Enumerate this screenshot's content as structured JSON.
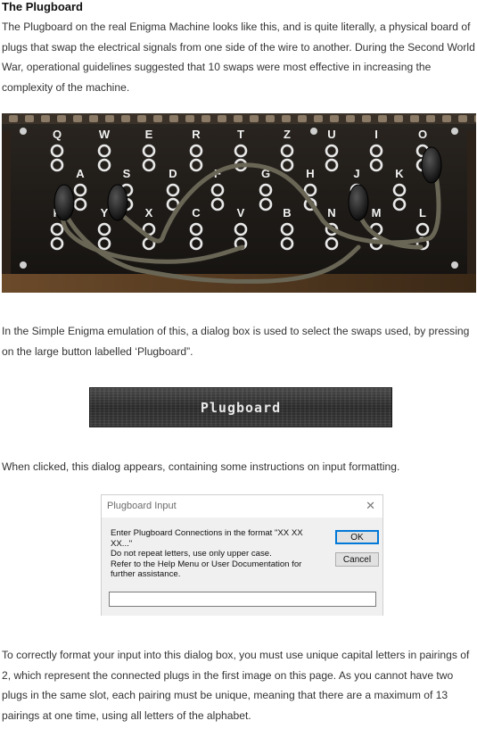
{
  "heading": "The Plugboard",
  "paragraphs": {
    "intro": "The Plugboard on the real Enigma Machine looks like this, and is quite literally, a physical board of plugs that swap the electrical signals from one side of the wire to another. During the Second World War, operational guidelines suggested that 10 swaps were most effective in increasing the complexity of the machine.",
    "emulation": "In the Simple Enigma emulation of this, a dialog box is used to select the swaps used, by pressing on the large button labelled ‘Plugboard”.",
    "clicked": "When clicked, this dialog appears, containing some instructions on input formatting.",
    "format": "To correctly format your input into this dialog box, you must use unique capital letters in pairings of 2, which represent the connected plugs in the first image on this page. As you cannot have two plugs in the same slot, each pairing must be unique, meaning that there are a maximum of 13 pairings at one time, using all letters of the alphabet."
  },
  "plugboard_photo": {
    "row1": [
      "Q",
      "W",
      "E",
      "R",
      "T",
      "Z",
      "U",
      "I",
      "O"
    ],
    "row2": [
      "A",
      "S",
      "D",
      "F",
      "G",
      "H",
      "J",
      "K"
    ],
    "row3": [
      "P",
      "Y",
      "X",
      "C",
      "V",
      "B",
      "N",
      "M",
      "L"
    ]
  },
  "plugboard_button": {
    "label": "Plugboard"
  },
  "dialog": {
    "title": "Plugboard Input",
    "close_glyph": "✕",
    "message_lines": [
      "Enter Plugboard Connections in the format \"XX XX XX...\"",
      "Do not repeat letters, use only upper case.",
      "Refer to the Help Menu or User Documentation for further assistance."
    ],
    "ok_label": "OK",
    "cancel_label": "Cancel",
    "input_value": ""
  },
  "colors": {
    "dialog_focus": "#0078d7",
    "dialog_body": "#f0f0f0",
    "photo_bg": "#1a1612"
  }
}
